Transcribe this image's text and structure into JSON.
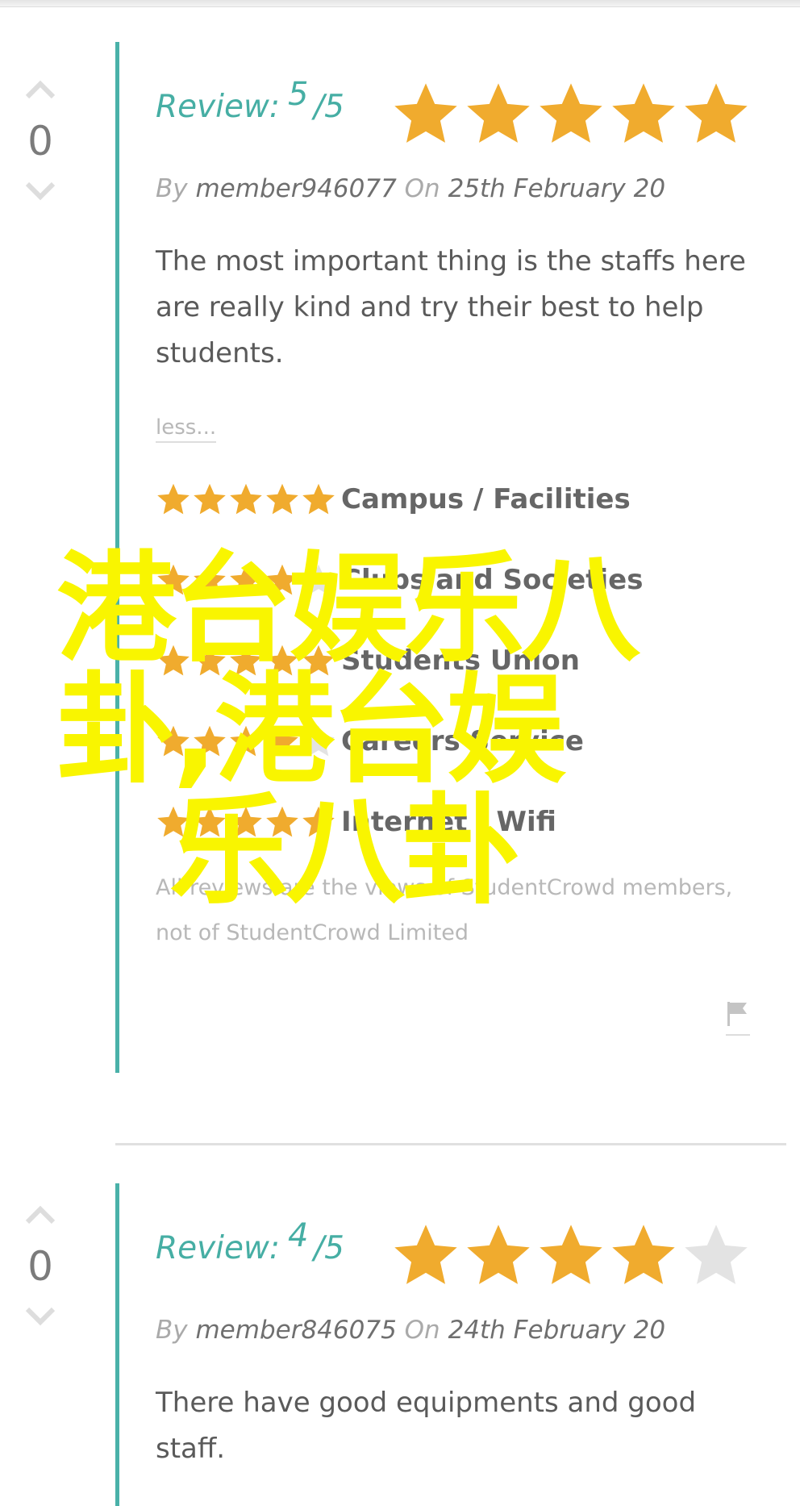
{
  "reviews": [
    {
      "votes": "0",
      "review_label": "Review:",
      "score": "5",
      "out_of": "/5",
      "rating": 5,
      "by_label": "By",
      "author": "member946077",
      "on_label": "On",
      "date": "25th February 20",
      "text": "The most important thing is the staffs here are really kind and try their best to help students.",
      "less_label": "less...",
      "categories": [
        {
          "label": "Campus / Facilities",
          "rating": 5
        },
        {
          "label": "Clubs and Societies",
          "rating": 4
        },
        {
          "label": "Students Union",
          "rating": 5
        },
        {
          "label": "Careers Service",
          "rating": 4
        },
        {
          "label": "Internet / Wifi",
          "rating": 5
        }
      ],
      "disclaimer": "All reviews are the views of StudentCrowd members, not of StudentCrowd Limited"
    },
    {
      "votes": "0",
      "review_label": "Review:",
      "score": "4",
      "out_of": "/5",
      "rating": 4,
      "by_label": "By",
      "author": "member846075",
      "on_label": "On",
      "date": "24th February 20",
      "text": "There have good equipments and good staff."
    }
  ],
  "watermark": {
    "line1": "港台娱乐八",
    "line2": "卦,港台娱",
    "line3": "乐八卦"
  },
  "colors": {
    "accent": "#4ab1a9",
    "star_on": "#f0ab2e",
    "star_off": "#e3e3e3",
    "watermark": "#f9f500"
  }
}
